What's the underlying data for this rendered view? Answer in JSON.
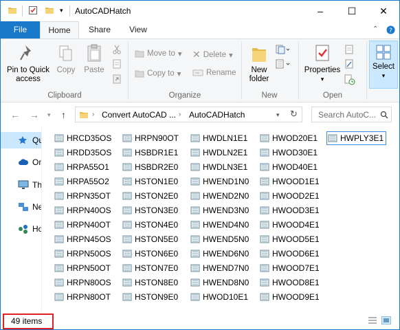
{
  "window": {
    "title": "AutoCADHatch",
    "controls": {
      "minimize": "–",
      "maximize": "☐",
      "close": "✕"
    }
  },
  "ribbon": {
    "tabs": [
      "File",
      "Home",
      "Share",
      "View"
    ],
    "clipboard": {
      "pin_label_1": "Pin to Quick",
      "pin_label_2": "access",
      "copy": "Copy",
      "paste": "Paste",
      "group_label": "Clipboard"
    },
    "organize": {
      "move_to": "Move to",
      "copy_to": "Copy to",
      "delete": "Delete",
      "rename": "Rename",
      "group_label": "Organize"
    },
    "new": {
      "new_folder_1": "New",
      "new_folder_2": "folder",
      "group_label": "New"
    },
    "open": {
      "properties": "Properties",
      "group_label": "Open"
    },
    "select": {
      "select": "Select"
    }
  },
  "address": {
    "crumb_1": "Convert AutoCAD ...",
    "crumb_2": "AutoCADHatch",
    "search_placeholder": "Search AutoC..."
  },
  "nav_pane": {
    "items": [
      {
        "label": "Qu",
        "icon": "star-icon"
      },
      {
        "label": "On",
        "icon": "cloud-icon"
      },
      {
        "label": "Th",
        "icon": "computer-icon"
      },
      {
        "label": "Ne",
        "icon": "network-icon"
      },
      {
        "label": "Ho",
        "icon": "homegroup-icon"
      }
    ]
  },
  "files": {
    "columns": [
      [
        "HRCD35OS",
        "HRDD35OS",
        "HRPA55O1",
        "HRPA55O2",
        "HRPN35OT",
        "HRPN40OS",
        "HRPN40OT",
        "HRPN45OS",
        "HRPN50OS",
        "HRPN50OT",
        "HRPN80OS",
        "HRPN80OT"
      ],
      [
        "HRPN90OT",
        "HSBDR1E1",
        "HSBDR2E0",
        "HSTON1E0",
        "HSTON2E0",
        "HSTON3E0",
        "HSTON4E0",
        "HSTON5E0",
        "HSTON6E0",
        "HSTON7E0",
        "HSTON8E0",
        "HSTON9E0"
      ],
      [
        "HWDLN1E1",
        "HWDLN2E1",
        "HWDLN3E1",
        "HWEND1N0",
        "HWEND2N0",
        "HWEND3N0",
        "HWEND4N0",
        "HWEND5N0",
        "HWEND6N0",
        "HWEND7N0",
        "HWEND8N0",
        "HWOD10E1"
      ],
      [
        "HWOD20E1",
        "HWOD30E1",
        "HWOD40E1",
        "HWOOD1E1",
        "HWOOD2E1",
        "HWOOD3E1",
        "HWOOD4E1",
        "HWOOD5E1",
        "HWOOD6E1",
        "HWOOD7E1",
        "HWOOD8E1",
        "HWOOD9E1"
      ],
      [
        "HWPLY3E1"
      ]
    ]
  },
  "status": {
    "item_count": "49 items"
  },
  "colors": {
    "accent": "#1979ca",
    "highlight_red": "#e02020",
    "selected_bg": "#cce8ff"
  }
}
